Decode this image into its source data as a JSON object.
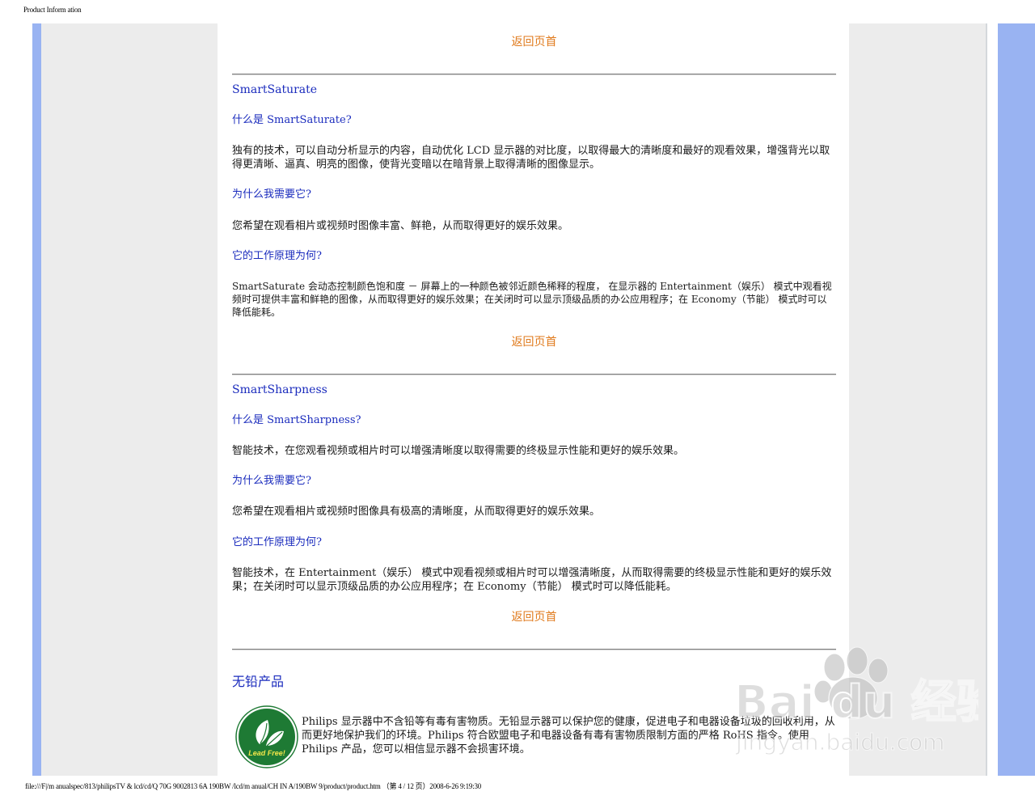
{
  "print": {
    "header": "Product Inform ation",
    "footer": "file:///F|/m anualspec/813/philipsTV & lcd/cd/Q 70G 9002813 6A 190BW /lcd/m anual/CH IN A/190BW 9/product/product.htm （第 4 / 12 页）2008-6-26 9:19:30"
  },
  "nav": {
    "back_to_top": "返回页首"
  },
  "smartsaturate": {
    "title": "SmartSaturate",
    "what_q": "什么是 SmartSaturate?",
    "what_a": "独有的技术，可以自动分析显示的内容，自动优化 LCD 显示器的对比度，以取得最大的清晰度和最好的观看效果，增强背光以取得更清晰、逼真、明亮的图像，使背光变暗以在暗背景上取得清晰的图像显示。",
    "why_q": "为什么我需要它?",
    "why_a": "您希望在观看相片或视频时图像丰富、鲜艳，从而取得更好的娱乐效果。",
    "how_q": "它的工作原理为何?",
    "how_a": "SmartSaturate 会动态控制颜色饱和度 － 屏幕上的一种颜色被邻近颜色稀释的程度， 在显示器的 Entertainment（娱乐） 模式中观看视频时可提供丰富和鲜艳的图像，从而取得更好的娱乐效果；在关闭时可以显示顶级品质的办公应用程序；在 Economy（节能） 模式时可以降低能耗。"
  },
  "smartsharpness": {
    "title": "SmartSharpness",
    "what_q": "什么是 SmartSharpness?",
    "what_a": "智能技术，在您观看视频或相片时可以增强清晰度以取得需要的终极显示性能和更好的娱乐效果。",
    "why_q": "为什么我需要它?",
    "why_a": "您希望在观看相片或视频时图像具有极高的清晰度，从而取得更好的娱乐效果。",
    "how_q": "它的工作原理为何?",
    "how_a": "智能技术，在 Entertainment（娱乐） 模式中观看视频或相片时可以增强清晰度，从而取得需要的终极显示性能和更好的娱乐效果；在关闭时可以显示顶级品质的办公应用程序；在 Economy（节能） 模式时可以降低能耗。"
  },
  "leadfree": {
    "title": "无铅产品",
    "logo_text": "Lead Free!",
    "text": "Philips 显示器中不含铅等有毒有害物质。无铅显示器可以保护您的健康，促进电子和电器设备垃圾的回收利用，从而更好地保护我们的环境。Philips 符合欧盟电子和电器设备有毒有害物质限制方面的严格 RoHS 指令。使用 Philips 产品，您可以相信显示器不会损害环境。"
  },
  "watermark": {
    "brand": "Bai du 经验",
    "url": "jingyan.baidu.com"
  },
  "colors": {
    "link_orange": "#e07a1c",
    "heading_blue": "#1a2bbd",
    "side_stripe": "#99b3f2",
    "side_panel": "#ececec",
    "logo_green": "#1e7a34"
  }
}
